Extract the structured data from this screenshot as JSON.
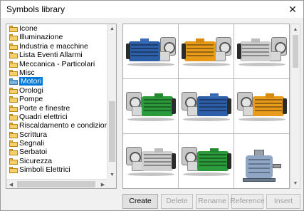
{
  "window": {
    "title": "Symbols library",
    "close_glyph": "✕"
  },
  "tree": {
    "items": [
      {
        "label": "Icone",
        "selected": false
      },
      {
        "label": "Illuminazione",
        "selected": false
      },
      {
        "label": "Industria e macchine",
        "selected": false
      },
      {
        "label": "Lista Eventi Allarmi",
        "selected": false
      },
      {
        "label": "Meccanica - Particolari",
        "selected": false
      },
      {
        "label": "Misc",
        "selected": false
      },
      {
        "label": "Motori",
        "selected": true
      },
      {
        "label": "Orologi",
        "selected": false
      },
      {
        "label": "Pompe",
        "selected": false
      },
      {
        "label": "Porte e finestre",
        "selected": false
      },
      {
        "label": "Quadri elettrici",
        "selected": false
      },
      {
        "label": "Riscaldamento e condizionamento",
        "selected": false
      },
      {
        "label": "Scrittura",
        "selected": false
      },
      {
        "label": "Segnali",
        "selected": false
      },
      {
        "label": "Serbatoi",
        "selected": false
      },
      {
        "label": "Sicurezza",
        "selected": false
      },
      {
        "label": "Simboli Elettrici",
        "selected": false
      }
    ]
  },
  "symbols": [
    {
      "name": "blue-motor",
      "color": "#2d5fa8",
      "box": "#3a6bb8",
      "flip": false
    },
    {
      "name": "orange-motor",
      "color": "#e89a1a",
      "box": "#d88a10",
      "flip": false
    },
    {
      "name": "gray-motor",
      "color": "#cfcfcf",
      "box": "#bdbdbd",
      "flip": false
    },
    {
      "name": "green-motor",
      "color": "#2a9a3a",
      "box": "#238a32",
      "flip": true
    },
    {
      "name": "blue-motor-2",
      "color": "#2d5fa8",
      "box": "#3a6bb8",
      "flip": true
    },
    {
      "name": "orange-motor-2",
      "color": "#e89a1a",
      "box": "#d88a10",
      "flip": true
    },
    {
      "name": "gray-motor-2",
      "color": "#cfcfcf",
      "box": "#bdbdbd",
      "flip": true
    },
    {
      "name": "green-motor-2",
      "color": "#2a9a3a",
      "box": "#238a32",
      "flip": true
    },
    {
      "name": "large-motor",
      "color": "#8fa6c4",
      "box": "#8fa6c4",
      "flip": false
    }
  ],
  "buttons": {
    "create": "Create",
    "delete": "Delete",
    "rename": "Rename",
    "reference": "Reference",
    "insert": "Insert"
  }
}
